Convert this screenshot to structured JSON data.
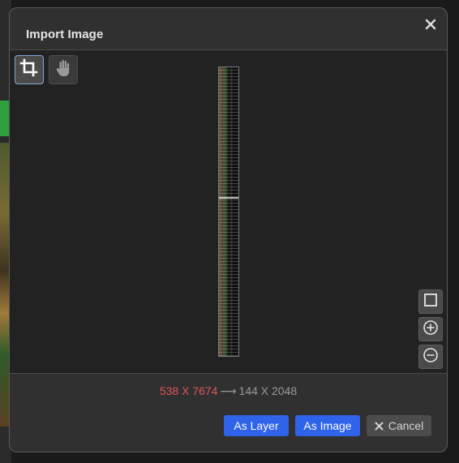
{
  "dialog": {
    "title": "Import Image",
    "close_icon": "close-icon"
  },
  "toolbar": {
    "crop_icon": "crop-icon",
    "hand_icon": "hand-pan-icon"
  },
  "view_controls": {
    "fit_icon": "square-fit-icon",
    "zoom_in_icon": "zoom-in-icon",
    "zoom_out_icon": "zoom-out-icon"
  },
  "dimensions": {
    "original": "538 X 7674",
    "arrow": "⟶",
    "scaled": "144 X 2048",
    "original_color": "#e05656"
  },
  "actions": {
    "as_layer": "As Layer",
    "as_image": "As Image",
    "cancel": "Cancel"
  },
  "colors": {
    "primary": "#2f63ea",
    "dialog_bg": "#303030",
    "preview_bg": "#222222"
  }
}
